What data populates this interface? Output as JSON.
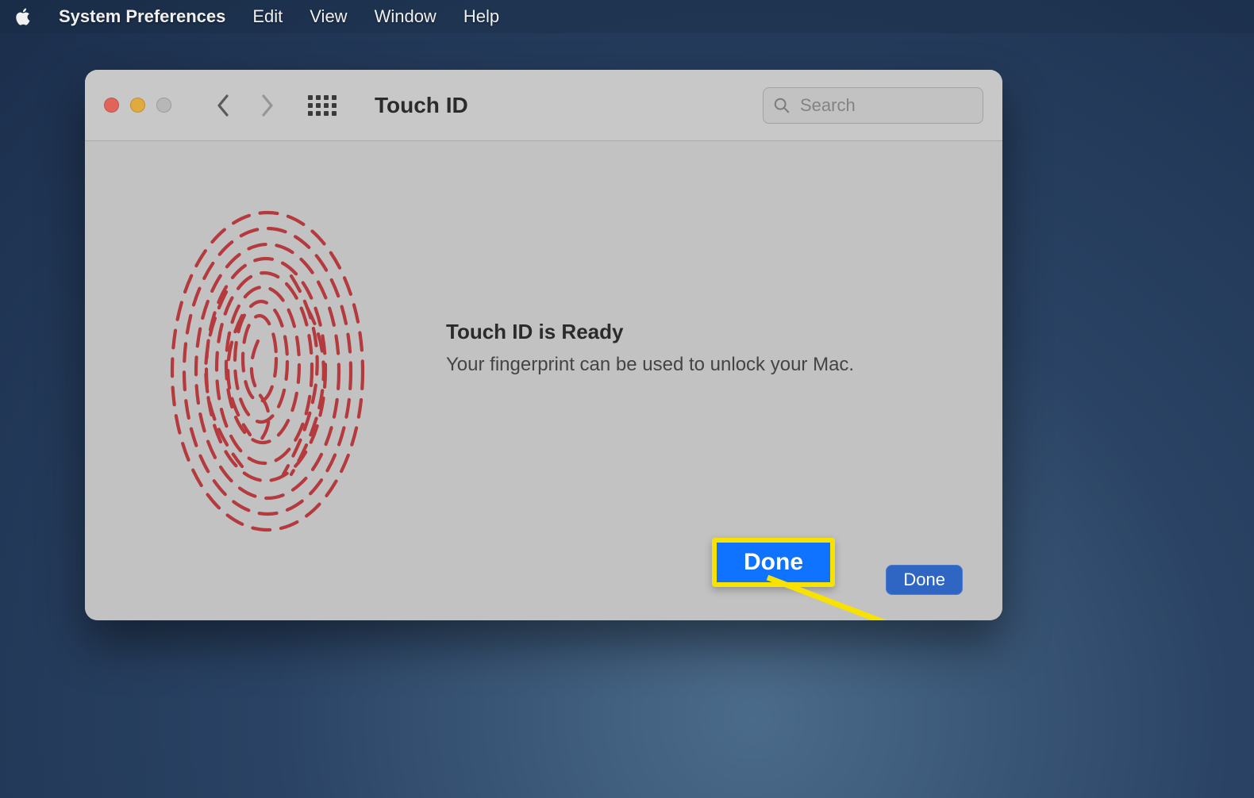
{
  "menubar": {
    "app_name": "System Preferences",
    "items": [
      "Edit",
      "View",
      "Window",
      "Help"
    ]
  },
  "toolbar": {
    "pane_title": "Touch ID",
    "search_placeholder": "Search"
  },
  "content": {
    "heading": "Touch ID is Ready",
    "subtext": "Your fingerprint can be used to unlock your Mac."
  },
  "buttons": {
    "done": "Done",
    "callout_done": "Done"
  }
}
